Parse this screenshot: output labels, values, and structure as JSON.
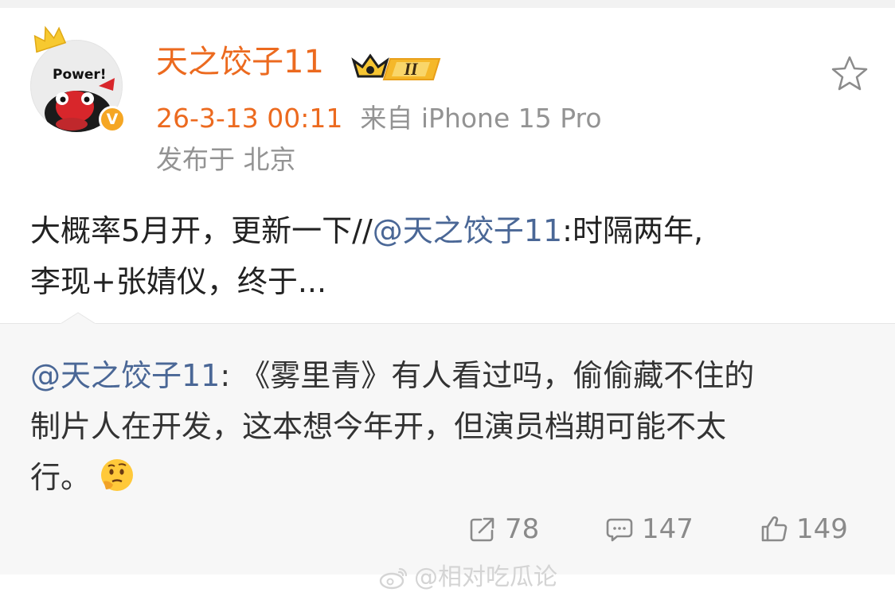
{
  "post": {
    "username": "天之饺子11",
    "level": "II",
    "timestamp": "26-3-13 00:11",
    "source": "来自 iPhone 15 Pro",
    "location": "发布于 北京",
    "text_line1_a": "大概率5月开，更新一下//",
    "text_line1_mention": "@天之饺子11",
    "text_line1_b": ":时隔两年,",
    "text_line2": "李现+张婧仪，终于..."
  },
  "avatar": {
    "label": "Power!"
  },
  "repost": {
    "mention": "@天之饺子11",
    "text_part1": ": 《雾里青》有人看过吗，偷偷藏不住的",
    "text_line2": "制片人在开发，这本想今年开，但演员档期可能不太",
    "text_line3": "行。"
  },
  "actions": {
    "repost_count": "78",
    "comment_count": "147",
    "like_count": "149"
  },
  "watermark": {
    "text": "@相对吃瓜论"
  },
  "colors": {
    "username": "#ec6a1f",
    "mention": "#4a6796",
    "secondary": "#939393",
    "vip_badge": "#f5a623"
  }
}
